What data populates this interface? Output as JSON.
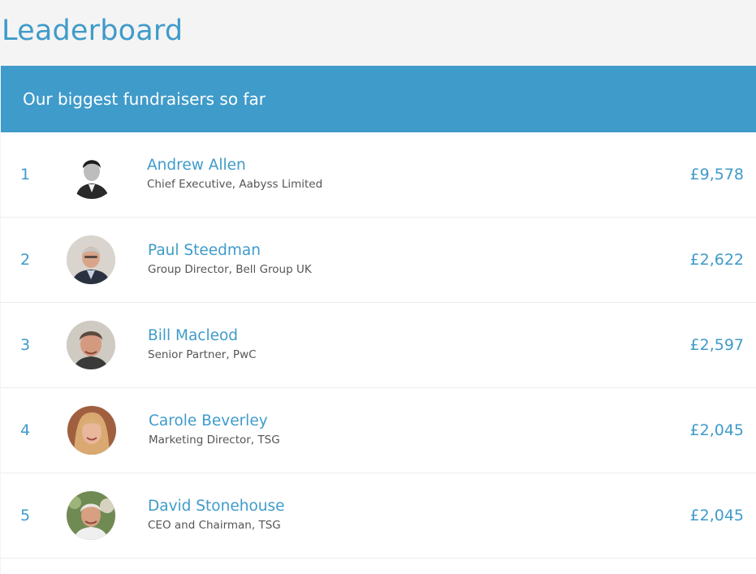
{
  "page": {
    "title": "Leaderboard"
  },
  "leaderboard": {
    "heading": "Our biggest fundraisers so far",
    "entries": [
      {
        "rank": "1",
        "name": "Andrew Allen",
        "role": "Chief Executive, Aabyss Limited",
        "amount": "£9,578",
        "avatar": "person-photo-bw"
      },
      {
        "rank": "2",
        "name": "Paul Steedman",
        "role": "Group Director, Bell Group UK",
        "amount": "£2,622",
        "avatar": "person-photo"
      },
      {
        "rank": "3",
        "name": "Bill Macleod",
        "role": "Senior Partner, PwC",
        "amount": "£2,597",
        "avatar": "person-photo"
      },
      {
        "rank": "4",
        "name": "Carole Beverley",
        "role": "Marketing Director, TSG",
        "amount": "£2,045",
        "avatar": "person-photo"
      },
      {
        "rank": "5",
        "name": "David Stonehouse",
        "role": "CEO and Chairman, TSG",
        "amount": "£2,045",
        "avatar": "person-photo"
      }
    ]
  },
  "colors": {
    "accent": "#3f9bca",
    "header_text": "#ffffff",
    "page_background": "#f4f4f4",
    "secondary_text": "#555555"
  }
}
